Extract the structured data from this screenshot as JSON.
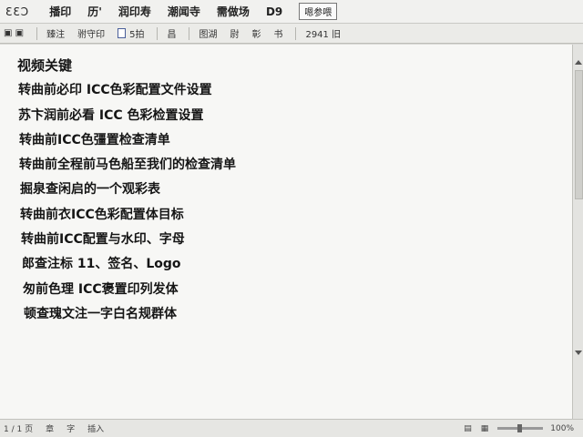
{
  "menubar": {
    "logo": "ƐƐƆ",
    "items": [
      "播印",
      "历'",
      "润印寿",
      "潮闻寺",
      "需做场",
      "D9"
    ],
    "badge": "嗯参喂"
  },
  "toolbar": {
    "buttons": [
      "▣ ▣",
      "臻注",
      "驸守印",
      "5拍",
      "昌",
      "图湖",
      "尉",
      "彰",
      "书",
      "2941 旧"
    ]
  },
  "document": {
    "lines": [
      "视频关键",
      "转曲前必印 ICC色彩配置文件设置",
      "苏卞润前必看 ICC 色彩检置设置",
      "转曲前ICC色彊置检查清单",
      "转曲前全程前马色船至我们的检查清单",
      "掘泉查闲启的一个观彩表",
      "转曲前衣ICC色彩配置体目标",
      "转曲前ICC配置与水印、字母",
      "郎查注标 11、签名、Logo",
      "匆前色理 ICC褒置印列发体",
      "顿查瑰文注一字白名规群体"
    ]
  },
  "statusbar": {
    "left": [
      "1 / 1 页",
      "章",
      "字",
      "插入"
    ],
    "right": [
      "▤",
      "▦",
      "100%"
    ]
  }
}
